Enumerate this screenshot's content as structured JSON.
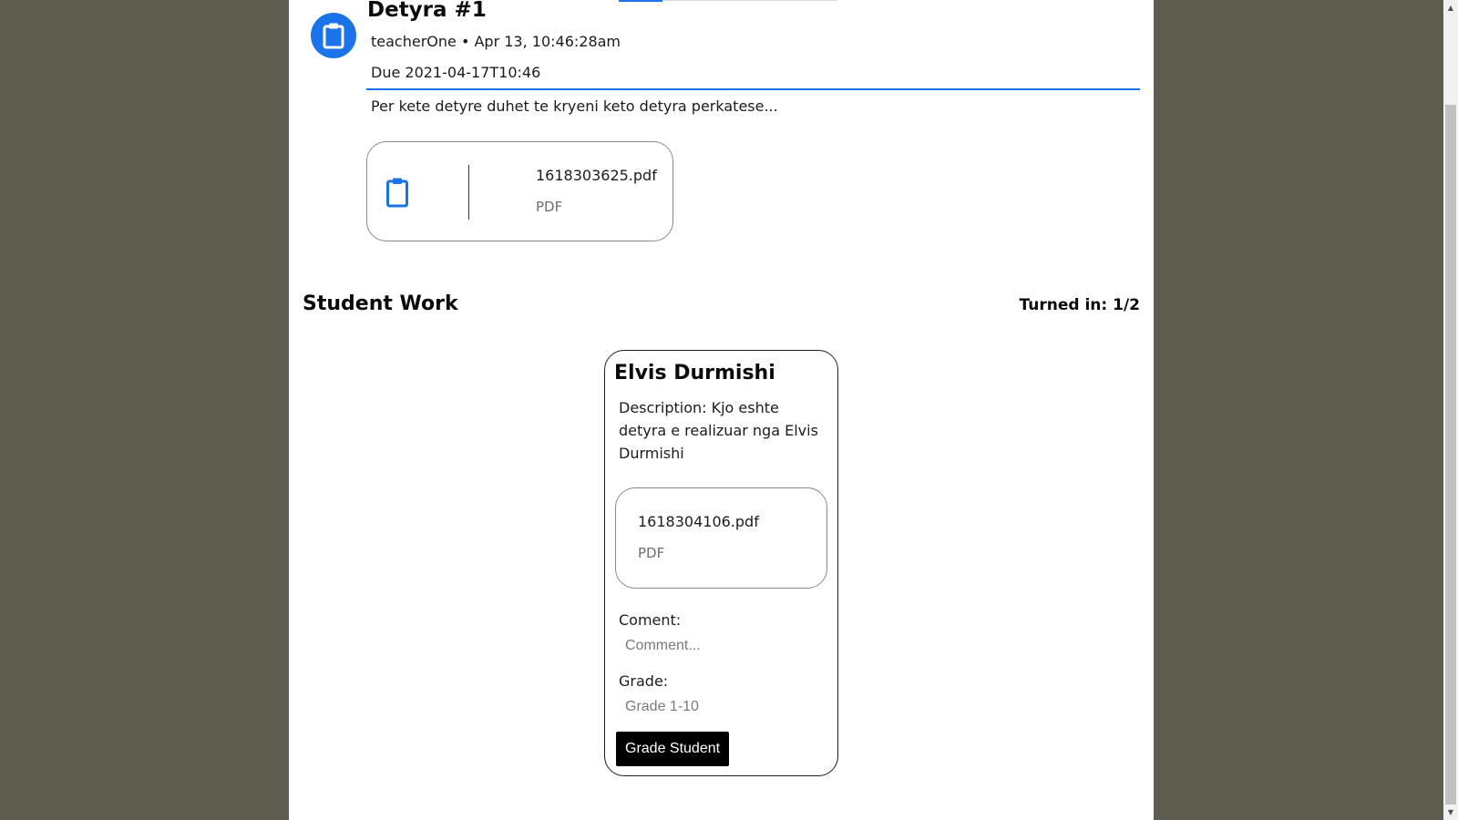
{
  "assignment": {
    "title": "Detyra #1",
    "meta": "teacherOne • Apr 13, 10:46:28am",
    "due": "Due 2021-04-17T10:46",
    "description": "Per kete detyre duhet te kryeni keto detyra perkatese...",
    "icon": "clipboard-icon",
    "accent_color": "#1a73e8",
    "attachment": {
      "name": "1618303625.pdf",
      "type": "PDF",
      "icon": "clipboard-icon"
    }
  },
  "student_work": {
    "title": "Student Work",
    "turned_in": "Turned in: 1/2",
    "submissions": [
      {
        "student_name": "Elvis Durmishi",
        "description": "Description: Kjo eshte detyra e realizuar nga Elvis Durmishi",
        "file": {
          "name": "1618304106.pdf",
          "type": "PDF"
        },
        "comment_label": "Coment:",
        "comment_placeholder": "Comment...",
        "grade_label": "Grade:",
        "grade_placeholder": "Grade 1-10",
        "grade_button": "Grade Student"
      }
    ]
  },
  "scrollbar": {
    "up_icon": "scroll-up-arrow-icon",
    "down_icon": "scroll-down-arrow-icon"
  }
}
